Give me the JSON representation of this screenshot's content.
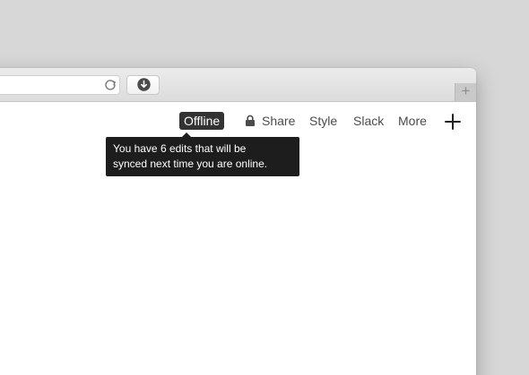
{
  "toolbar": {
    "status_badge": "Offline",
    "share_label": "Share",
    "style_label": "Style",
    "slack_label": "Slack",
    "more_label": "More",
    "add_icon": "plus-icon",
    "lock_icon": "lock-icon"
  },
  "tooltip": {
    "line1": "You have 6 edits that will be",
    "line2": "synced next time you are online."
  },
  "browser": {
    "reload_icon": "reload-icon",
    "download_icon": "download-icon",
    "newtab_icon": "plus-icon",
    "newtab_label": "+"
  },
  "colors": {
    "badge_bg": "#333333",
    "tooltip_bg": "#1d1d1d",
    "text": "#4b4b4b"
  }
}
